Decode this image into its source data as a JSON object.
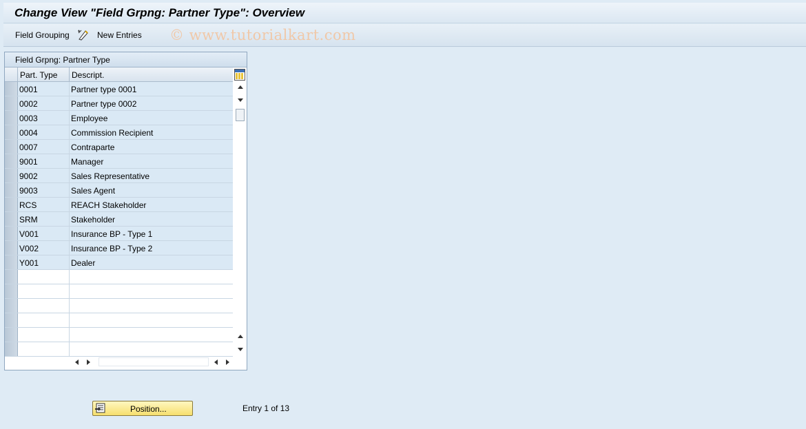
{
  "window": {
    "title": "Change View \"Field Grpng: Partner Type\": Overview"
  },
  "toolbar": {
    "field_grouping_label": "Field Grouping",
    "new_entries_label": "New Entries",
    "watermark": "© www.tutorialkart.com"
  },
  "table": {
    "title": "Field Grpng: Partner Type",
    "columns": [
      "Part. Type",
      "Descript."
    ],
    "rows": [
      [
        "0001",
        "Partner type 0001"
      ],
      [
        "0002",
        "Partner type 0002"
      ],
      [
        "0003",
        "Employee"
      ],
      [
        "0004",
        "Commission Recipient"
      ],
      [
        "0007",
        "Contraparte"
      ],
      [
        "9001",
        "Manager"
      ],
      [
        "9002",
        "Sales Representative"
      ],
      [
        "9003",
        "Sales Agent"
      ],
      [
        "RCS",
        "REACH Stakeholder"
      ],
      [
        "SRM",
        "Stakeholder"
      ],
      [
        "V001",
        "Insurance BP - Type 1"
      ],
      [
        "V002",
        "Insurance BP - Type 2"
      ],
      [
        "Y001",
        "Dealer"
      ]
    ]
  },
  "footer": {
    "position_button_label": "Position...",
    "entry_status": "Entry 1 of 13"
  }
}
